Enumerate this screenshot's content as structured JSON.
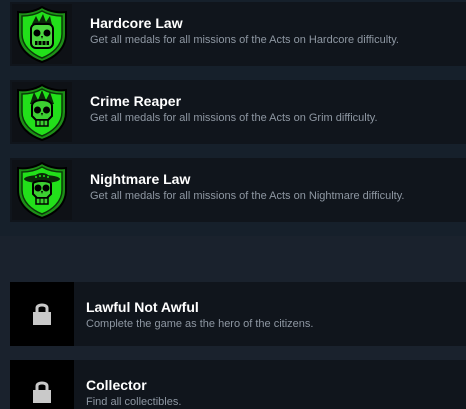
{
  "achievements": {
    "unlocked": [
      {
        "title": "Hardcore Law",
        "description": "Get all medals for all missions of the Acts on Hardcore difficulty.",
        "icon": "zombie-badge-icon"
      },
      {
        "title": "Crime Reaper",
        "description": "Get all medals for all missions of the Acts on Grim difficulty.",
        "icon": "skull-reaper-badge-icon"
      },
      {
        "title": "Nightmare Law",
        "description": "Get all medals for all missions of the Acts on Nightmare difficulty.",
        "icon": "skull-sombrero-badge-icon"
      }
    ],
    "locked": [
      {
        "title": "Lawful Not Awful",
        "description": "Complete the game as the hero of the citizens.",
        "icon": "lock-icon"
      },
      {
        "title": "Collector",
        "description": "Find all collectibles.",
        "icon": "lock-icon"
      }
    ]
  },
  "colors": {
    "background": "#1a222d",
    "row": "#10151c",
    "badge_green": "#22e01a",
    "title": "#ffffff",
    "description": "#8e97a2",
    "lock": "#c9c9c9"
  }
}
